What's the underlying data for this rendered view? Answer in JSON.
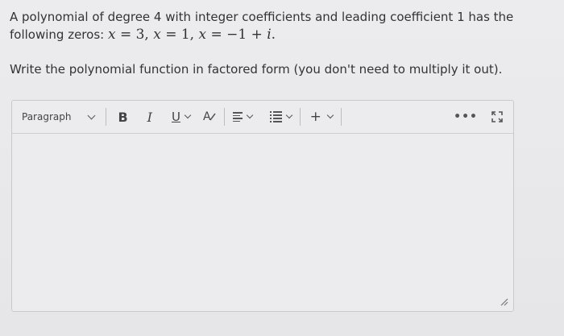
{
  "question": {
    "line1": "A polynomial of degree 4 with integer coefficients and leading coefficient 1 has the",
    "line2_prefix": "following zeros:",
    "zeros_math": "𝑥 = 3, 𝑥 = 1, 𝑥 = −1 + 𝑖."
  },
  "instruction": "Write the polynomial function in factored form (you don't need to multiply it out).",
  "toolbar": {
    "paragraph_label": "Paragraph",
    "bold_label": "B",
    "italic_label": "I",
    "underline_label": "U",
    "text_color_label": "A",
    "insert_label": "+",
    "more_label": "•••"
  },
  "editor": {
    "content": ""
  }
}
